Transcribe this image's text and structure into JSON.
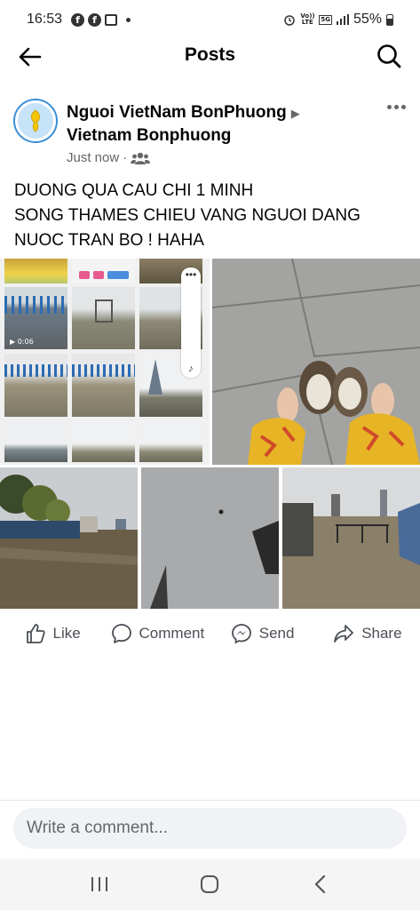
{
  "status_bar": {
    "time": "16:53",
    "network": "5G",
    "volte": "Vo)) LTE",
    "battery": "55%",
    "icons": [
      "facebook-icon",
      "facebook-icon",
      "gallery-icon",
      "dot-icon",
      "alarm-icon",
      "signal-icon",
      "battery-icon"
    ]
  },
  "header": {
    "title": "Posts",
    "back_icon": "back-arrow-icon",
    "search_icon": "search-icon"
  },
  "post": {
    "author": "Nguoi VietNam BonPhuong",
    "group": "Vietnam Bonphuong",
    "time": "Just now",
    "audience_icon": "group-audience-icon",
    "text_lines": [
      "DUONG QUA CAU CHI 1 MINH",
      "SONG THAMES CHIEU VANG NGUOI DANG",
      "NUOC TRAN BO ! HAHA"
    ],
    "video_duration": "0:06"
  },
  "actions": {
    "like": "Like",
    "comment": "Comment",
    "send": "Send",
    "share": "Share"
  },
  "comment": {
    "placeholder": "Write a comment..."
  },
  "colors": {
    "text": "#050505",
    "secondary": "#65676b",
    "input_bg": "#f0f2f5",
    "accent": "#1877f2"
  }
}
